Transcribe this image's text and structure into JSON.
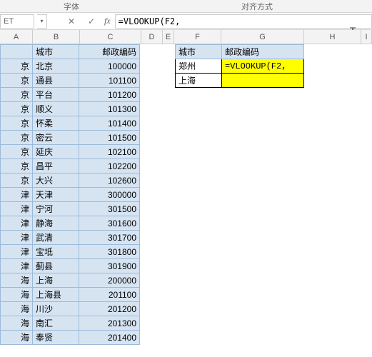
{
  "ribbon": {
    "group1": "字体",
    "group2": "对齐方式"
  },
  "namebox": {
    "value": "ET"
  },
  "formula_bar": {
    "cancel": "✕",
    "confirm": "✓",
    "fx": "fx",
    "formula": "=VLOOKUP(F2,"
  },
  "columns": {
    "A": "A",
    "B": "B",
    "C": "C",
    "D": "D",
    "E": "E",
    "F": "F",
    "G": "G",
    "H": "H",
    "I": "I"
  },
  "left_headers": {
    "city": "城市",
    "postal": "邮政编码"
  },
  "left_rows": [
    {
      "a": "京",
      "b": "北京",
      "c": "100000"
    },
    {
      "a": "京",
      "b": "通县",
      "c": "101100"
    },
    {
      "a": "京",
      "b": "平台",
      "c": "101200"
    },
    {
      "a": "京",
      "b": "顺义",
      "c": "101300"
    },
    {
      "a": "京",
      "b": "怀柔",
      "c": "101400"
    },
    {
      "a": "京",
      "b": "密云",
      "c": "101500"
    },
    {
      "a": "京",
      "b": "延庆",
      "c": "102100"
    },
    {
      "a": "京",
      "b": "昌平",
      "c": "102200"
    },
    {
      "a": "京",
      "b": "大兴",
      "c": "102600"
    },
    {
      "a": "津",
      "b": "天津",
      "c": "300000"
    },
    {
      "a": "津",
      "b": "宁河",
      "c": "301500"
    },
    {
      "a": "津",
      "b": "静海",
      "c": "301600"
    },
    {
      "a": "津",
      "b": "武清",
      "c": "301700"
    },
    {
      "a": "津",
      "b": "宝坻",
      "c": "301800"
    },
    {
      "a": "津",
      "b": "蓟县",
      "c": "301900"
    },
    {
      "a": "海",
      "b": "上海",
      "c": "200000"
    },
    {
      "a": "海",
      "b": "上海县",
      "c": "201100"
    },
    {
      "a": "海",
      "b": "川沙",
      "c": "201200"
    },
    {
      "a": "海",
      "b": "南汇",
      "c": "201300"
    },
    {
      "a": "海",
      "b": "奉贤",
      "c": "201400"
    }
  ],
  "right_headers": {
    "city": "城市",
    "postal": "邮政编码"
  },
  "right_rows": [
    {
      "f": "郑州",
      "g": "=VLOOKUP(F2,"
    },
    {
      "f": "上海",
      "g": ""
    }
  ]
}
